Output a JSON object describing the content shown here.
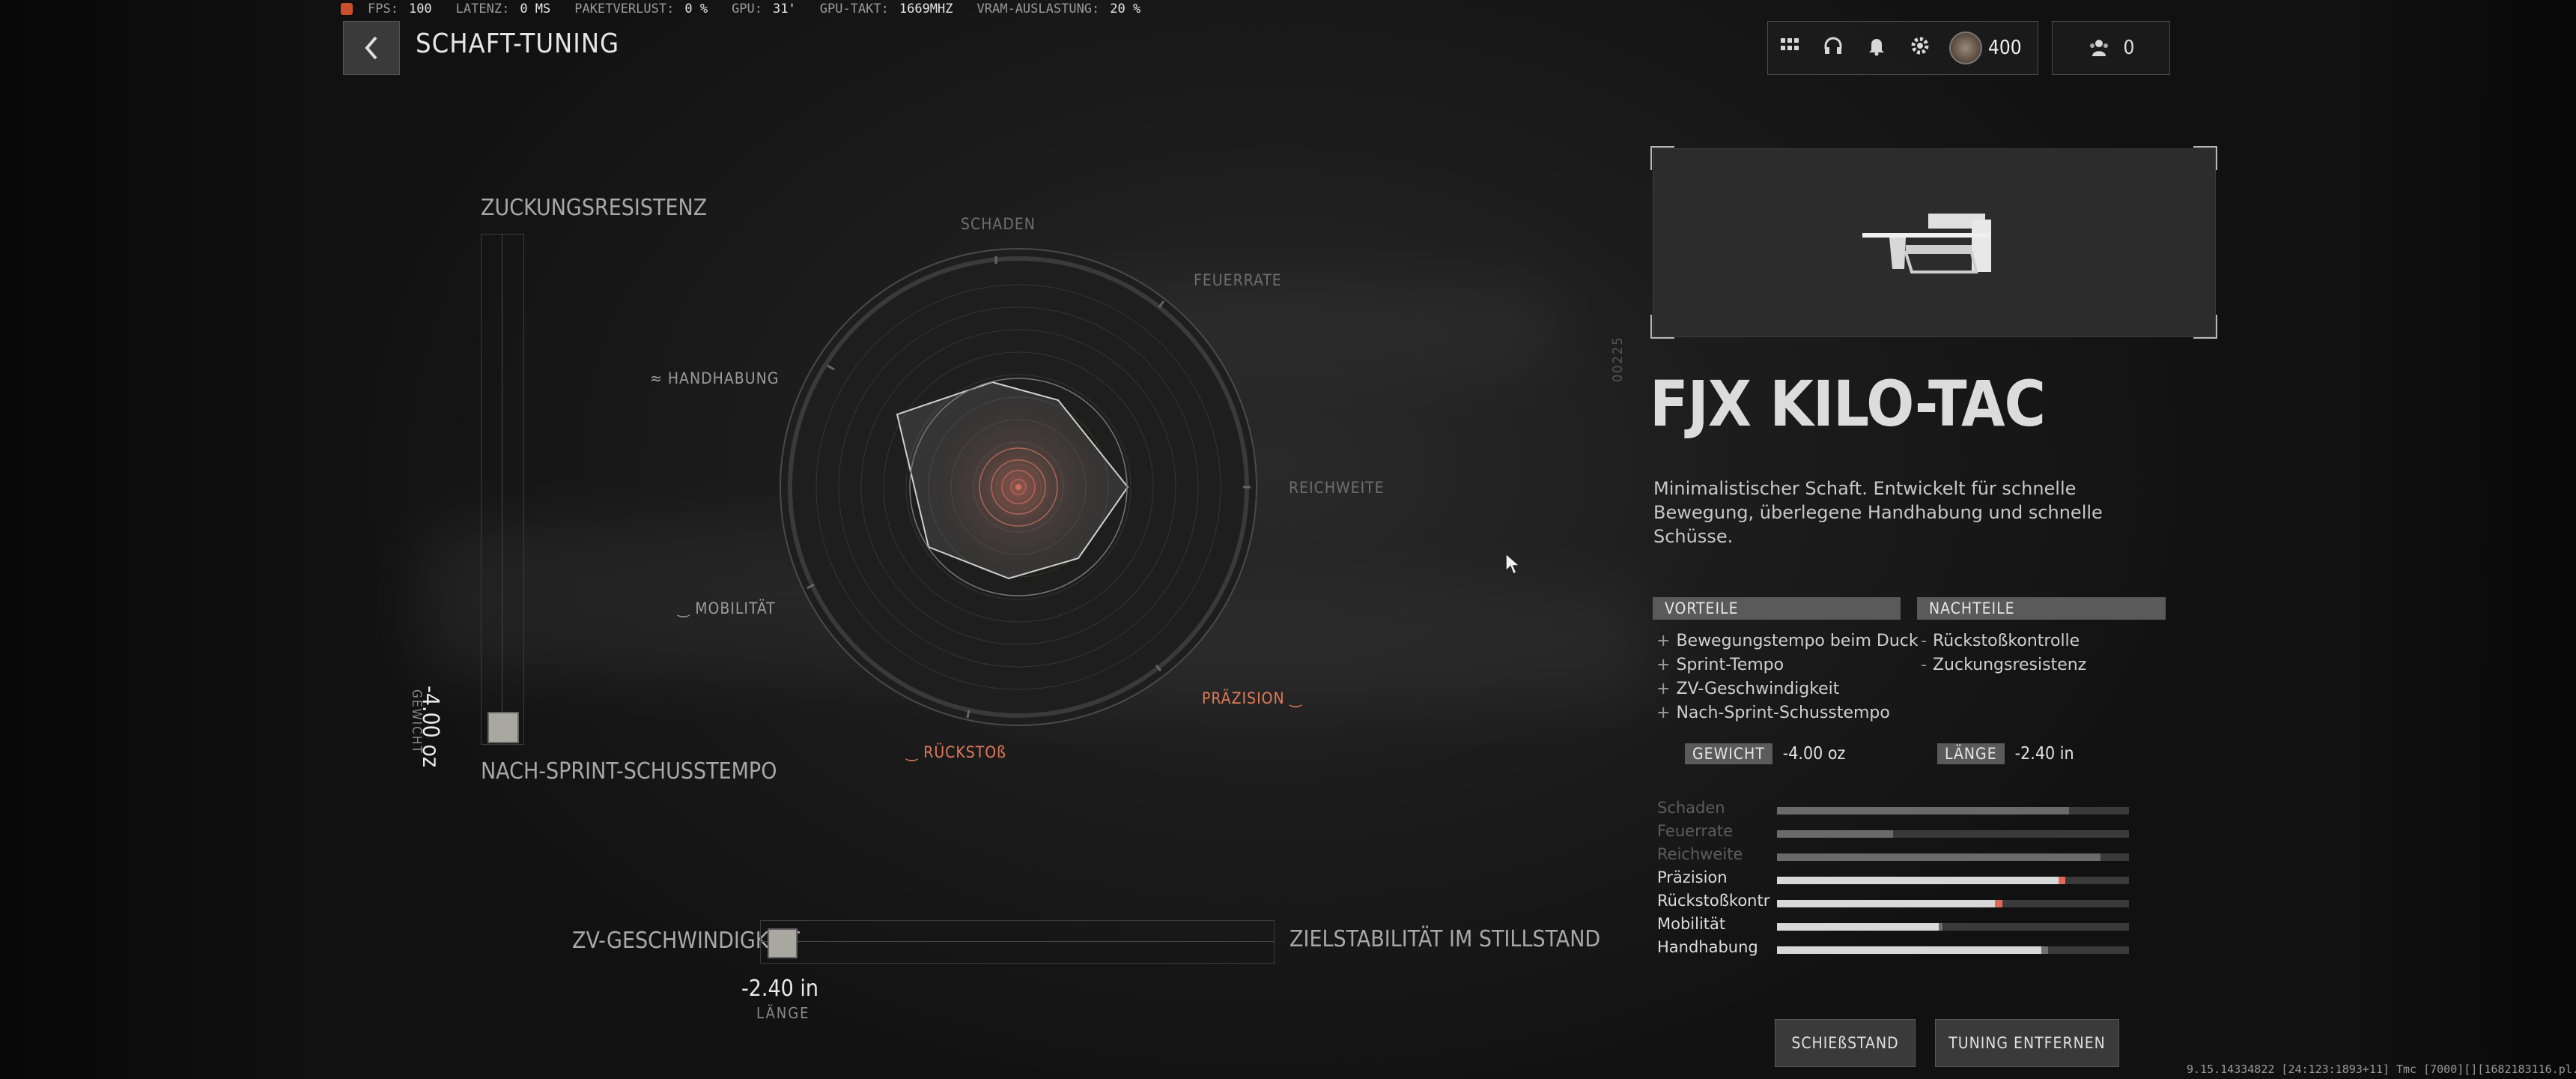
{
  "perf": {
    "items": [
      {
        "k": "FPS:",
        "v": "100"
      },
      {
        "k": "LATENZ:",
        "v": "0 MS"
      },
      {
        "k": "PAKETVERLUST:",
        "v": "0  %"
      },
      {
        "k": "GPU:",
        "v": "31'"
      },
      {
        "k": "GPU-TAKT:",
        "v": "1669MHZ"
      },
      {
        "k": "VRAM-AUSLASTUNG:",
        "v": "20  %"
      }
    ]
  },
  "header": {
    "back_icon": "chevron-left",
    "title": "SCHAFT-TUNING"
  },
  "topbar": {
    "currency": "400",
    "friends": "0"
  },
  "vslider": {
    "label_top": "ZUCKUNGSRESISTENZ",
    "label_bottom": "NACH-SPRINT-SCHUSSTEMPO",
    "value": "-4.00 oz",
    "sub": "GEWICHT"
  },
  "hslider": {
    "label_left": "ZV-GESCHWINDIGKEIT",
    "label_right": "ZIELSTABILITÄT IM STILLSTAND",
    "value": "-2.40 in",
    "sub": "LÄNGE"
  },
  "radar": {
    "labels": {
      "schaden": "SCHADEN",
      "feuerrate": "FEUERRATE",
      "reichweite": "REICHWEITE",
      "praezision": "PRÄZISION",
      "rueckstoss": "RÜCKSTOß",
      "mobilitaet": "MOBILITÄT",
      "handhabung": "HANDHABUNG"
    }
  },
  "weapon": {
    "serial": "00225",
    "name": "FJX KILO-TAC",
    "description": "Minimalistischer Schaft. Entwickelt für schnelle Bewegung, überlegene Handhabung und schnelle Schüsse."
  },
  "pros": {
    "title": "VORTEILE",
    "items": [
      "Bewegungstempo beim Duck",
      "Sprint-Tempo",
      "ZV-Geschwindigkeit",
      "Nach-Sprint-Schusstempo"
    ]
  },
  "cons": {
    "title": "NACHTEILE",
    "items": [
      "Rückstoßkontrolle",
      "Zuckungsresistenz"
    ]
  },
  "meta": {
    "weight_tag": "GEWICHT",
    "weight_val": "-4.00  oz",
    "length_tag": "LÄNGE",
    "length_val": "-2.40  in"
  },
  "stats": [
    {
      "label": "Schaden",
      "value": 0.83,
      "delta": 0,
      "dim": true
    },
    {
      "label": "Feuerrate",
      "value": 0.33,
      "delta": 0,
      "dim": true
    },
    {
      "label": "Reichweite",
      "value": 0.92,
      "delta": 0,
      "dim": true
    },
    {
      "label": "Präzision",
      "value": 0.8,
      "delta": 0.02,
      "dim": false,
      "delta_color": "#e06a55"
    },
    {
      "label": "Rückstoßkontr",
      "value": 0.62,
      "delta": 0.02,
      "dim": false,
      "delta_color": "#e06a55"
    },
    {
      "label": "Mobilität",
      "value": 0.46,
      "delta": 0.01,
      "dim": false,
      "delta_color": "#6f6f6f"
    },
    {
      "label": "Handhabung",
      "value": 0.75,
      "delta": 0.02,
      "dim": false,
      "delta_color": "#6f6f6f"
    }
  ],
  "buttons": {
    "range": "SCHIEßSTAND",
    "remove": "TUNING ENTFERNEN"
  },
  "build": "9.15.14334822 [24:123:1893+11] Tmc [7000][][1682183116.pl.G.steam]",
  "colors": {
    "accent": "#e07a5a",
    "panel": "#5a5a5a"
  }
}
